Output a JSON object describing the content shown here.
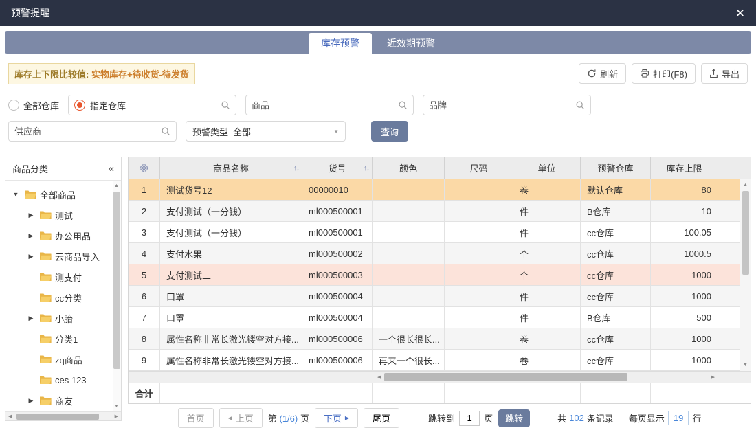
{
  "dialog": {
    "title": "预警提醒",
    "close_icon": "✕"
  },
  "tabs": [
    {
      "label": "库存预警",
      "active": true
    },
    {
      "label": "近效期预警",
      "active": false
    }
  ],
  "notice": {
    "label": "库存上下限比较值:",
    "value": "实物库存+待收货-待发货"
  },
  "toolbar": {
    "refresh": "刷新",
    "print": "打印(F8)",
    "export": "导出"
  },
  "filters": {
    "radio_all": "全部仓库",
    "radio_specified": "指定仓库",
    "product_placeholder": "商品",
    "brand_placeholder": "品牌",
    "supplier_placeholder": "供应商",
    "warn_type_label": "预警类型",
    "warn_type_value": "全部",
    "query_button": "查询"
  },
  "sidebar": {
    "title": "商品分类",
    "collapse_icon": "«",
    "tree": [
      {
        "label": "全部商品",
        "level": 0,
        "caret": "expanded"
      },
      {
        "label": "测试",
        "level": 1,
        "caret": "collapsed"
      },
      {
        "label": "办公用品",
        "level": 1,
        "caret": "collapsed"
      },
      {
        "label": "云商品导入",
        "level": 1,
        "caret": "collapsed"
      },
      {
        "label": "测支付",
        "level": 1,
        "caret": "none"
      },
      {
        "label": "cc分类",
        "level": 1,
        "caret": "none"
      },
      {
        "label": "小胎",
        "level": 1,
        "caret": "collapsed"
      },
      {
        "label": "分类1",
        "level": 1,
        "caret": "none"
      },
      {
        "label": "zq商品",
        "level": 1,
        "caret": "none"
      },
      {
        "label": "ces 123",
        "level": 1,
        "caret": "none"
      },
      {
        "label": "商友",
        "level": 1,
        "caret": "collapsed"
      }
    ]
  },
  "table": {
    "columns": [
      {
        "label": "商品名称",
        "sortable": true
      },
      {
        "label": "货号",
        "sortable": true
      },
      {
        "label": "颜色",
        "sortable": false
      },
      {
        "label": "尺码",
        "sortable": false
      },
      {
        "label": "单位",
        "sortable": false
      },
      {
        "label": "预警仓库",
        "sortable": false
      },
      {
        "label": "库存上限",
        "sortable": false
      }
    ],
    "rows": [
      {
        "no": "1",
        "name": "测试货号12",
        "sku": "00000010",
        "color": "",
        "size": "",
        "unit": "卷",
        "warehouse": "默认仓库",
        "limit": "80",
        "state": "selected"
      },
      {
        "no": "2",
        "name": "支付测试（一分钱）",
        "sku": "ml000500001",
        "color": "",
        "size": "",
        "unit": "件",
        "warehouse": "B仓库",
        "limit": "10",
        "state": ""
      },
      {
        "no": "3",
        "name": "支付测试（一分钱）",
        "sku": "ml000500001",
        "color": "",
        "size": "",
        "unit": "件",
        "warehouse": "cc仓库",
        "limit": "100.05",
        "state": ""
      },
      {
        "no": "4",
        "name": "支付水果",
        "sku": "ml000500002",
        "color": "",
        "size": "",
        "unit": "个",
        "warehouse": "cc仓库",
        "limit": "1000.5",
        "state": ""
      },
      {
        "no": "5",
        "name": "支付测试二",
        "sku": "ml000500003",
        "color": "",
        "size": "",
        "unit": "个",
        "warehouse": "cc仓库",
        "limit": "1000",
        "state": "warning"
      },
      {
        "no": "6",
        "name": "口罩",
        "sku": "ml000500004",
        "color": "",
        "size": "",
        "unit": "件",
        "warehouse": "cc仓库",
        "limit": "1000",
        "state": ""
      },
      {
        "no": "7",
        "name": "口罩",
        "sku": "ml000500004",
        "color": "",
        "size": "",
        "unit": "件",
        "warehouse": "B仓库",
        "limit": "500",
        "state": ""
      },
      {
        "no": "8",
        "name": "属性名称非常长激光镂空对方接...",
        "sku": "ml000500006",
        "color": "一个很长很长...",
        "size": "",
        "unit": "卷",
        "warehouse": "cc仓库",
        "limit": "1000",
        "state": ""
      },
      {
        "no": "9",
        "name": "属性名称非常长激光镂空对方接...",
        "sku": "ml000500006",
        "color": "再来一个很长...",
        "size": "",
        "unit": "卷",
        "warehouse": "cc仓库",
        "limit": "1000",
        "state": ""
      }
    ],
    "total_label": "合计"
  },
  "pagination": {
    "first": "首页",
    "prev": "上页",
    "page_prefix": "第",
    "page_current": "(1/6)",
    "page_suffix": "页",
    "next": "下页",
    "last": "尾页",
    "jump_label": "跳转到",
    "jump_value": "1",
    "jump_unit": "页",
    "jump_button": "跳转",
    "total_prefix": "共",
    "total_count": "102",
    "total_suffix": "条记录",
    "per_page_label": "每页显示",
    "per_page_value": "19",
    "per_page_unit": "行"
  },
  "icons": {
    "sort": "↑↓",
    "caret_expanded": "▼",
    "caret_collapsed": "▶",
    "dropdown": "▼",
    "scroll_up": "▲",
    "scroll_down": "▼",
    "scroll_left": "◀",
    "scroll_right": "▶",
    "prev_triangle": "◀",
    "next_triangle": "▶"
  },
  "colors": {
    "titlebar_bg": "#2b3244",
    "tabbar_bg": "#7d89a7",
    "tab_active_text": "#4a6bbd",
    "notice_bg": "#fdf7e2",
    "notice_border": "#e9d79f",
    "notice_label": "#9e7c2b",
    "notice_value": "#cc7e2b",
    "primary_button_bg": "#6a7b9d",
    "selected_row_bg": "#fbd9a6",
    "warning_row_bg": "#fce3da",
    "radio_checked": "#e8562d",
    "link_blue": "#4a87d9",
    "next_blue": "#4a6fc4"
  }
}
